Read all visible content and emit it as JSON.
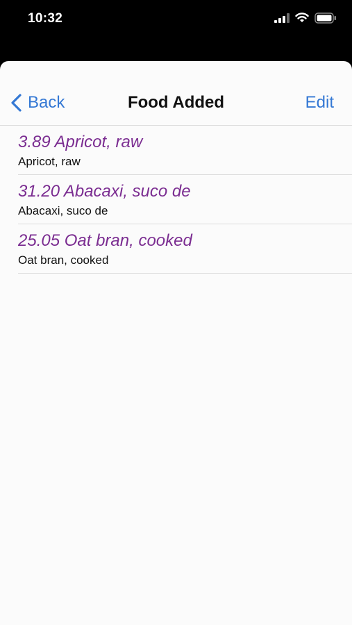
{
  "status_bar": {
    "time": "10:32",
    "icons": [
      "cellular-signal-icon",
      "wifi-icon",
      "battery-icon"
    ]
  },
  "nav": {
    "back_label": "Back",
    "title": "Food Added",
    "edit_label": "Edit"
  },
  "items": [
    {
      "title": "3.89 Apricot, raw",
      "subtitle": "Apricot, raw"
    },
    {
      "title": "31.20 Abacaxi, suco de",
      "subtitle": "Abacaxi, suco de"
    },
    {
      "title": "25.05 Oat bran, cooked",
      "subtitle": "Oat bran, cooked"
    }
  ],
  "colors": {
    "accent": "#3478d4",
    "item_title": "#7b2d91",
    "background": "#fbfbfb"
  }
}
